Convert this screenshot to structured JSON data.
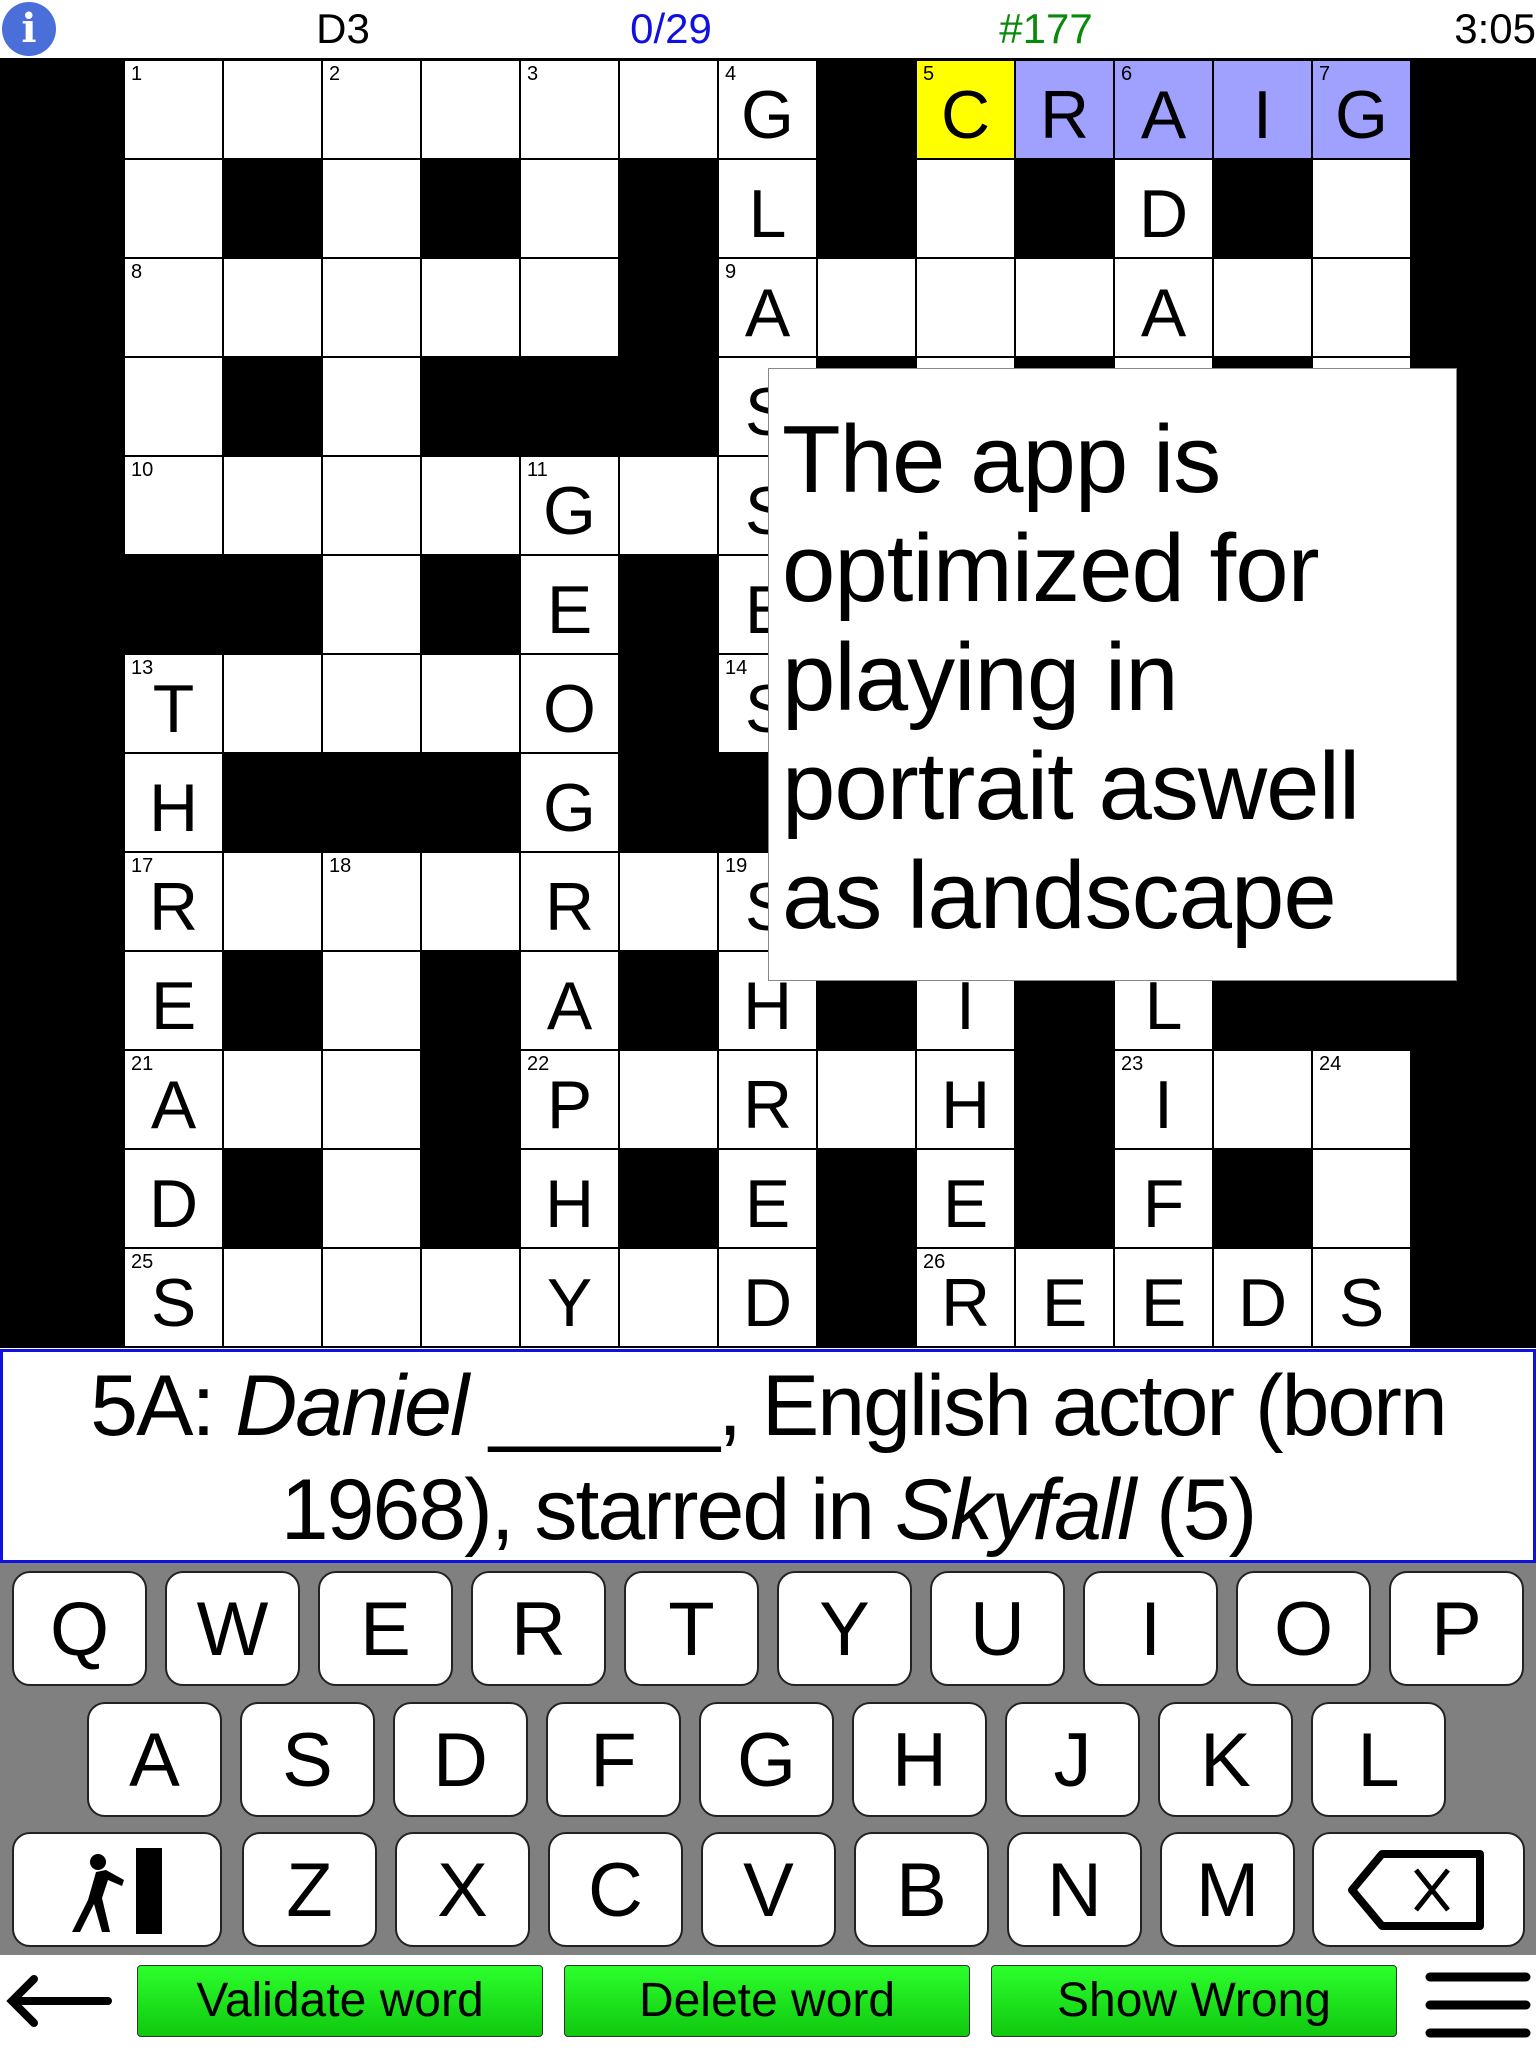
{
  "topbar": {
    "info_icon": "info-icon",
    "cell_ref": "D3",
    "progress": "0/29",
    "puzzle_number": "#177",
    "timer": "3:05",
    "colors": {
      "progress": "#1010e0",
      "puzzle_number": "#0a8a0a"
    }
  },
  "grid": {
    "rows": [
      "......G#CRAIG",
      ".#.#.#L#.#D#.",
      ".....#A...A..",
      ".#.###S#.#.#.",
      "....G.S......",
      "##.#E#E#.###.",
      "T...O#S#.....",
      "H###G###.#.##",
      "R...R.S......",
      "E#.#A#H#I#L##",
      "A..#P.R.H#I..",
      "D#.#H#E#E#F#.",
      "S...Y.D#REEDS"
    ],
    "numbers": [
      {
        "r": 0,
        "c": 0,
        "n": "1"
      },
      {
        "r": 0,
        "c": 2,
        "n": "2"
      },
      {
        "r": 0,
        "c": 4,
        "n": "3"
      },
      {
        "r": 0,
        "c": 6,
        "n": "4"
      },
      {
        "r": 0,
        "c": 8,
        "n": "5"
      },
      {
        "r": 0,
        "c": 10,
        "n": "6"
      },
      {
        "r": 0,
        "c": 12,
        "n": "7"
      },
      {
        "r": 2,
        "c": 0,
        "n": "8"
      },
      {
        "r": 2,
        "c": 6,
        "n": "9"
      },
      {
        "r": 4,
        "c": 0,
        "n": "10"
      },
      {
        "r": 4,
        "c": 4,
        "n": "11"
      },
      {
        "r": 6,
        "c": 0,
        "n": "13"
      },
      {
        "r": 6,
        "c": 6,
        "n": "14"
      },
      {
        "r": 8,
        "c": 0,
        "n": "17"
      },
      {
        "r": 8,
        "c": 2,
        "n": "18"
      },
      {
        "r": 8,
        "c": 6,
        "n": "19"
      },
      {
        "r": 10,
        "c": 0,
        "n": "21"
      },
      {
        "r": 10,
        "c": 4,
        "n": "22"
      },
      {
        "r": 10,
        "c": 10,
        "n": "23"
      },
      {
        "r": 10,
        "c": 12,
        "n": "24"
      },
      {
        "r": 12,
        "c": 0,
        "n": "25"
      },
      {
        "r": 12,
        "c": 8,
        "n": "26"
      }
    ],
    "selected_cell": {
      "r": 0,
      "c": 8
    },
    "selected_word": {
      "r": 0,
      "c_start": 8,
      "c_end": 12
    },
    "colors": {
      "selected_cell": "#ffff00",
      "selected_word": "#a0a0ff"
    }
  },
  "popup": {
    "text": "The app is optimized for playing in portrait aswell as landscape"
  },
  "clue": {
    "prefix": "5A: ",
    "italic1": "Daniel",
    "blank": " _____",
    "mid": ", English actor (born 1968), starred in ",
    "italic2": "Skyfall",
    "suffix": " (5)"
  },
  "keyboard": {
    "row1": [
      "Q",
      "W",
      "E",
      "R",
      "T",
      "Y",
      "U",
      "I",
      "O",
      "P"
    ],
    "row2": [
      "A",
      "S",
      "D",
      "F",
      "G",
      "H",
      "J",
      "K",
      "L"
    ],
    "row3": [
      "Z",
      "X",
      "C",
      "V",
      "B",
      "N",
      "M"
    ],
    "exit_icon": "exit-door-icon",
    "backspace_icon": "backspace-icon"
  },
  "bottombar": {
    "back_icon": "back-arrow-icon",
    "validate": "Validate word",
    "delete": "Delete word",
    "show_wrong": "Show Wrong",
    "menu_icon": "hamburger-menu-icon"
  }
}
